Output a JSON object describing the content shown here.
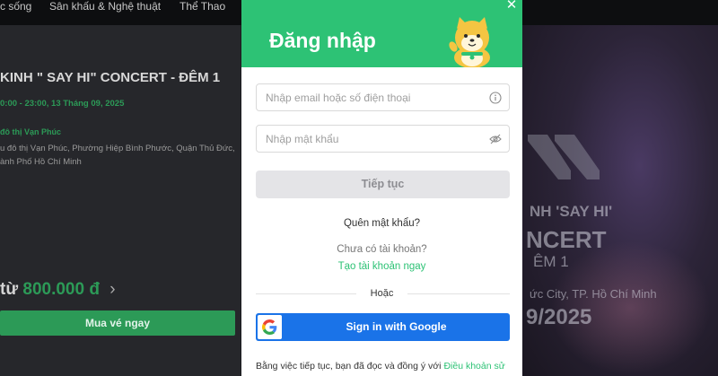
{
  "nav": {
    "items": [
      "c sống",
      "Sân khấu & Nghệ thuật",
      "Thể Thao"
    ]
  },
  "event": {
    "title": "KINH \" SAY HI\" CONCERT - ĐÊM 1",
    "time": "0:00 - 23:00, 13 Tháng 09, 2025",
    "venue": "đô thị Vạn Phúc",
    "address": "u đô thị Vạn Phúc, Phường Hiệp Bình Phước, Quận Thủ Đức, ành Phố Hồ Chí Minh",
    "price_prefix": "từ",
    "price": "800.000 đ",
    "buy_label": "Mua vé ngay"
  },
  "poster": {
    "line1": "NH 'SAY HI'",
    "line2": "NCERT",
    "line3": "ÊM 1",
    "line4": "ức City, TP. Hồ Chí Minh",
    "line5": "9/2025"
  },
  "modal": {
    "title": "Đăng nhập",
    "close_icon": "close-icon",
    "email_placeholder": "Nhập email hoặc số điện thoại",
    "password_placeholder": "Nhập mật khẩu",
    "continue_label": "Tiếp tục",
    "forgot_label": "Quên mật khẩu?",
    "no_account_label": "Chưa có tài khoản?",
    "create_account_label": "Tạo tài khoản ngay",
    "or_label": "Hoặc",
    "google_label": "Sign in with Google",
    "terms_prefix": "Bằng việc tiếp tục, bạn đã đọc và đồng ý với ",
    "terms_link": "Điều khoản sử"
  },
  "colors": {
    "brand_green": "#2dc275",
    "google_blue": "#1a73e8",
    "continue_disabled_bg": "#e4e4e7"
  }
}
